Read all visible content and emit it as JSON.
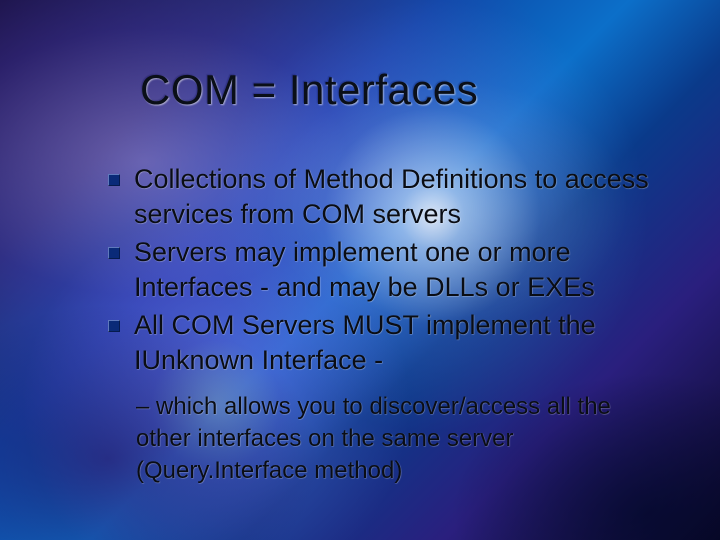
{
  "title": "COM = Interfaces",
  "bullets": [
    "Collections of Method Definitions to access services from COM servers",
    "Servers may implement one or more Interfaces - and may be DLLs or EXEs",
    "All COM Servers MUST implement the IUnknown Interface -"
  ],
  "sub_bullet": "– which allows you to discover/access all the other interfaces on the same server (Query.Interface method)"
}
